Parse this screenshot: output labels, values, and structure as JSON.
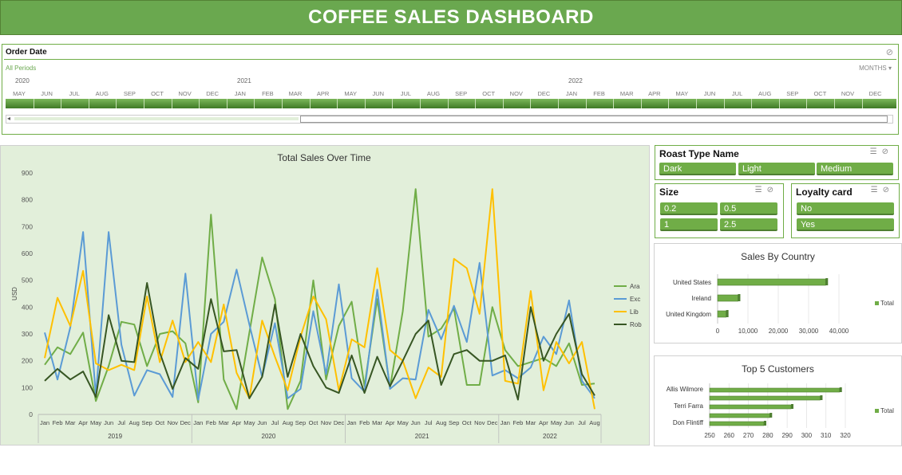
{
  "dashboard": {
    "title": "COFFEE SALES DASHBOARD"
  },
  "timeline": {
    "header": "Order Date",
    "periods_label": "All Periods",
    "level_label": "MONTHS ▾",
    "years": [
      "2020",
      "2021",
      "2022"
    ],
    "months": [
      "MAY",
      "JUN",
      "JUL",
      "AUG",
      "SEP",
      "OCT",
      "NOV",
      "DEC",
      "JAN",
      "FEB",
      "MAR",
      "APR",
      "MAY",
      "JUN",
      "JUL",
      "AUG",
      "SEP",
      "OCT",
      "NOV",
      "DEC",
      "JAN",
      "FEB",
      "MAR",
      "APR",
      "MAY",
      "JUN",
      "JUL",
      "AUG",
      "SEP",
      "OCT",
      "NOV",
      "DEC"
    ],
    "left_arrow": "◂"
  },
  "colors": {
    "accent": "#70ad47",
    "ara": "#70ad47",
    "exc": "#5b9bd5",
    "lib": "#ffc000",
    "rob": "#375623"
  },
  "roast_slicer": {
    "header": "Roast Type Name",
    "items": [
      "Dark",
      "Light",
      "Medium"
    ]
  },
  "size_slicer": {
    "header": "Size",
    "items": [
      "0.2",
      "0.5",
      "1",
      "2.5"
    ]
  },
  "loyalty_slicer": {
    "header": "Loyalty card",
    "items": [
      "No",
      "Yes"
    ]
  },
  "chart_data": [
    {
      "type": "line",
      "title": "Total Sales Over Time",
      "ylabel": "USD",
      "xlabel": "",
      "ylim": [
        0,
        900
      ],
      "yticks": [
        "0",
        "100",
        "200",
        "300",
        "400",
        "500",
        "600",
        "700",
        "800",
        "900"
      ],
      "x": [
        "Jan",
        "Feb",
        "Mar",
        "Apr",
        "May",
        "Jun",
        "Jul",
        "Aug",
        "Sep",
        "Oct",
        "Nov",
        "Dec",
        "Jan",
        "Feb",
        "Mar",
        "Apr",
        "May",
        "Jun",
        "Jul",
        "Aug",
        "Sep",
        "Oct",
        "Nov",
        "Dec",
        "Jan",
        "Feb",
        "Mar",
        "Apr",
        "May",
        "Jun",
        "Jul",
        "Aug",
        "Sep",
        "Oct",
        "Nov",
        "Dec",
        "Jan",
        "Feb",
        "Mar",
        "Apr",
        "May",
        "Jun",
        "Jul",
        "Aug"
      ],
      "years": [
        "2019",
        "2020",
        "2021",
        "2022"
      ],
      "legend_position": "right",
      "series": [
        {
          "name": "Ara",
          "values": [
            185,
            250,
            225,
            305,
            50,
            180,
            345,
            335,
            180,
            300,
            310,
            265,
            45,
            745,
            130,
            20,
            305,
            585,
            430,
            20,
            125,
            500,
            130,
            330,
            420,
            105,
            430,
            100,
            385,
            840,
            290,
            320,
            395,
            110,
            110,
            400,
            240,
            180,
            195,
            210,
            180,
            265,
            110,
            115
          ]
        },
        {
          "name": "Exc",
          "values": [
            305,
            130,
            325,
            680,
            70,
            680,
            260,
            70,
            165,
            150,
            65,
            525,
            55,
            300,
            345,
            540,
            335,
            140,
            340,
            60,
            95,
            385,
            150,
            485,
            135,
            85,
            465,
            95,
            135,
            130,
            390,
            280,
            405,
            270,
            565,
            145,
            165,
            135,
            175,
            290,
            225,
            425,
            125,
            60
          ]
        },
        {
          "name": "Lib",
          "values": [
            210,
            435,
            330,
            535,
            190,
            165,
            185,
            165,
            440,
            195,
            350,
            195,
            270,
            195,
            410,
            155,
            60,
            350,
            215,
            90,
            290,
            440,
            355,
            90,
            280,
            250,
            545,
            240,
            200,
            60,
            175,
            140,
            580,
            545,
            375,
            840,
            125,
            115,
            460,
            90,
            270,
            190,
            270,
            20
          ]
        },
        {
          "name": "Rob",
          "values": [
            125,
            170,
            130,
            160,
            65,
            370,
            200,
            195,
            490,
            230,
            95,
            210,
            170,
            430,
            235,
            240,
            60,
            140,
            410,
            140,
            300,
            180,
            100,
            80,
            220,
            80,
            215,
            105,
            200,
            300,
            350,
            110,
            225,
            240,
            200,
            200,
            220,
            55,
            400,
            200,
            300,
            375,
            150,
            70
          ]
        }
      ]
    },
    {
      "type": "bar",
      "title": "Sales By Country",
      "categories": [
        "United States",
        "Ireland",
        "United Kingdom"
      ],
      "values": [
        35600,
        6700,
        2800
      ],
      "xlim": [
        0,
        40000
      ],
      "xticks": [
        "0",
        "10,000",
        "20,000",
        "30,000",
        "40,000"
      ],
      "legend": "Total",
      "legend_position": "right"
    },
    {
      "type": "bar",
      "title": "Top 5 Customers",
      "categories": [
        "Allis Wilmore",
        "",
        "Terri Farra",
        "",
        "Don Flintiff"
      ],
      "values": [
        317,
        307,
        292,
        281,
        278
      ],
      "xlim": [
        250,
        320
      ],
      "xticks": [
        "250",
        "260",
        "270",
        "280",
        "290",
        "300",
        "310",
        "320"
      ],
      "legend": "Total",
      "legend_position": "right"
    }
  ]
}
